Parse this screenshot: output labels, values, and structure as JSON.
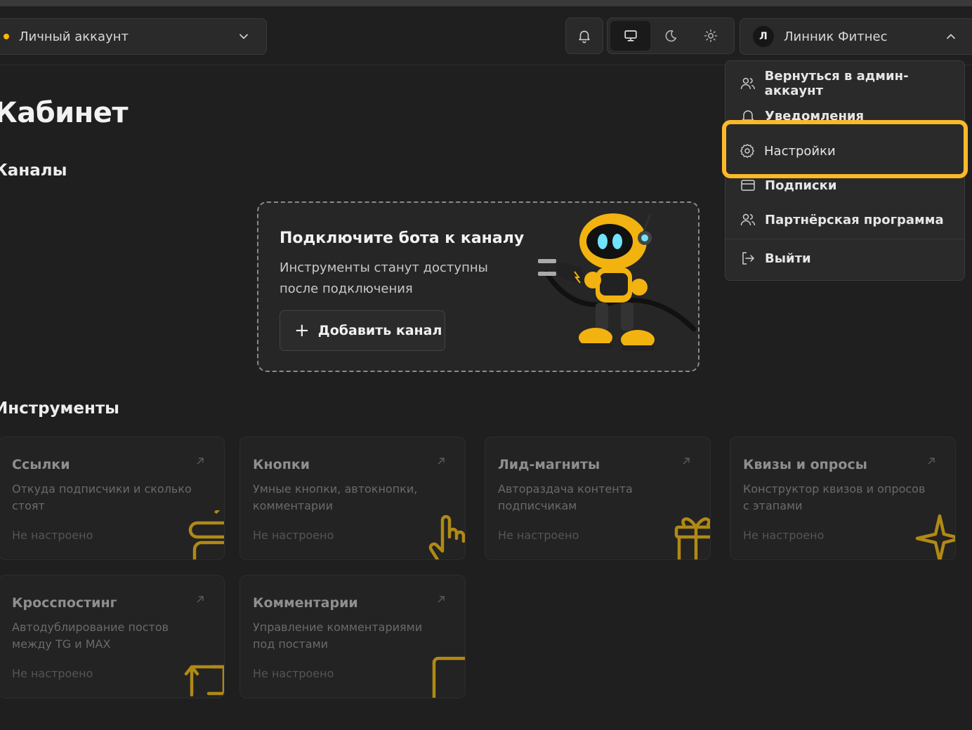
{
  "header": {
    "account_label": "Личный аккаунт",
    "user_initial": "Л",
    "user_name": "Линник Фитнес"
  },
  "user_menu": {
    "items": [
      {
        "label": "Вернуться в админ-аккаунт",
        "icon": "users-icon"
      },
      {
        "label": "Уведомления",
        "icon": "bell-icon"
      },
      {
        "label": "Настройки",
        "icon": "gear-icon"
      },
      {
        "label": "Подписки",
        "icon": "card-icon"
      },
      {
        "label": "Партнёрская программа",
        "icon": "users-icon"
      },
      {
        "label": "Выйти",
        "icon": "logout-icon"
      }
    ],
    "highlight_color": "#fbb929"
  },
  "page": {
    "title": "Кабинет",
    "channels_heading": "Каналы",
    "tools_heading": "Инструменты"
  },
  "connect_card": {
    "title": "Подключите бота к каналу",
    "subtitle": "Инструменты станут доступны после подключения",
    "add_button": "Добавить канал"
  },
  "tools": [
    {
      "title": "Ссылки",
      "desc": "Откуда подписчики и сколько стоят",
      "status": "Не настроено"
    },
    {
      "title": "Кнопки",
      "desc": "Умные кнопки, автокнопки, комментарии",
      "status": "Не настроено"
    },
    {
      "title": "Лид-магниты",
      "desc": "Автораздача контента подписчикам",
      "status": "Не настроено"
    },
    {
      "title": "Квизы и опросы",
      "desc": "Конструктор квизов и опросов с этапами",
      "status": "Не настроено"
    },
    {
      "title": "Кросспостинг",
      "desc": "Автодублирование постов между TG и MAX",
      "status": "Не настроено"
    },
    {
      "title": "Комментарии",
      "desc": "Управление комментариями под постами",
      "status": "Не настроено"
    }
  ],
  "accent_color": "#f5b800"
}
